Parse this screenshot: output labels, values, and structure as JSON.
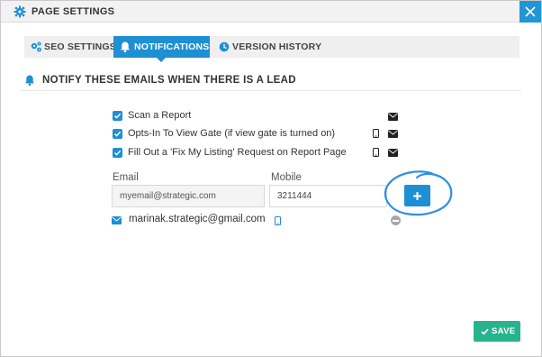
{
  "window": {
    "title": "PAGE SETTINGS",
    "close_icon": "close-icon"
  },
  "tabs": [
    {
      "label": "SEO SETTINGS",
      "icon": "gears-icon",
      "active": false
    },
    {
      "label": "NOTIFICATIONS",
      "icon": "bell-icon",
      "active": true
    },
    {
      "label": "VERSION HISTORY",
      "icon": "clock-icon",
      "active": false
    }
  ],
  "section": {
    "title": "NOTIFY THESE EMAILS WHEN THERE IS A LEAD",
    "icon": "bell-icon"
  },
  "options": [
    {
      "label": "Scan a Report",
      "checked": true,
      "channels": [
        "email"
      ]
    },
    {
      "label": "Opts-In To View Gate (if view gate is turned on)",
      "checked": true,
      "channels": [
        "phone",
        "email"
      ]
    },
    {
      "label": "Fill Out a 'Fix My Listing' Request on Report Page",
      "checked": true,
      "channels": [
        "phone",
        "email"
      ]
    }
  ],
  "form": {
    "email_label": "Email",
    "mobile_label": "Mobile",
    "email_placeholder": "myemail@strategic.com",
    "mobile_value": "3211444",
    "add_icon": "plus-icon"
  },
  "recipients": [
    {
      "email": "marinak.strategic@gmail.com",
      "has_phone": true
    }
  ],
  "footer": {
    "save_label": "SAVE",
    "save_icon": "check-icon"
  },
  "colors": {
    "accent": "#1e8fd3",
    "save": "#28b38f",
    "remove": "#a8a8a8"
  }
}
